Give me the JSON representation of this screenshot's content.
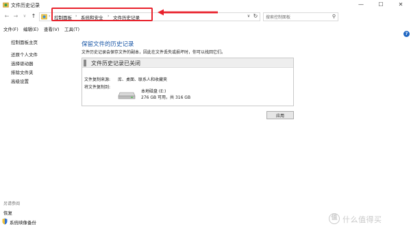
{
  "window": {
    "title": "文件历史记录",
    "minimize_glyph": "—",
    "maximize_glyph": "☐",
    "close_glyph": "✕"
  },
  "nav": {
    "back_glyph": "←",
    "forward_glyph": "→",
    "recent_glyph": "∨",
    "up_glyph": "↑",
    "breadcrumb": [
      "控制面板",
      "系统和安全",
      "文件历史记录"
    ],
    "separator": "›",
    "dropdown_glyph": "∨",
    "refresh_glyph": "↻",
    "search_placeholder": "搜索控制面板",
    "search_icon": "⚲"
  },
  "menu": {
    "file": "文件(F)",
    "edit": "编辑(E)",
    "view": "查看(V)",
    "tools": "工具(T)"
  },
  "sidebar": {
    "home": "控制面板主页",
    "links": [
      "还原个人文件",
      "选择驱动器",
      "排除文件夹",
      "高级设置"
    ],
    "see_also": "另请参阅",
    "recovery": "恢复",
    "system_image": "系统映像备份"
  },
  "main": {
    "title": "保留文件的历史记录",
    "description": "文件历史记录会保存文件的副本，因此在文件丢失或损坏时，你可以找回它们。",
    "status": "文件历史记录已关闭",
    "source_label": "文件复制来源:",
    "source_value": "库、桌面、联系人和收藏夹",
    "target_label": "将文件复制到:",
    "drive_name": "本地磁盘 (E:)",
    "drive_space": "276 GB 可用，共 316 GB",
    "apply": "应用"
  },
  "help": "?",
  "watermark": {
    "badge": "值",
    "text": "什么值得买"
  },
  "colors": {
    "accent_blue": "#1e5aa8",
    "annotation_red": "#e8202a"
  }
}
